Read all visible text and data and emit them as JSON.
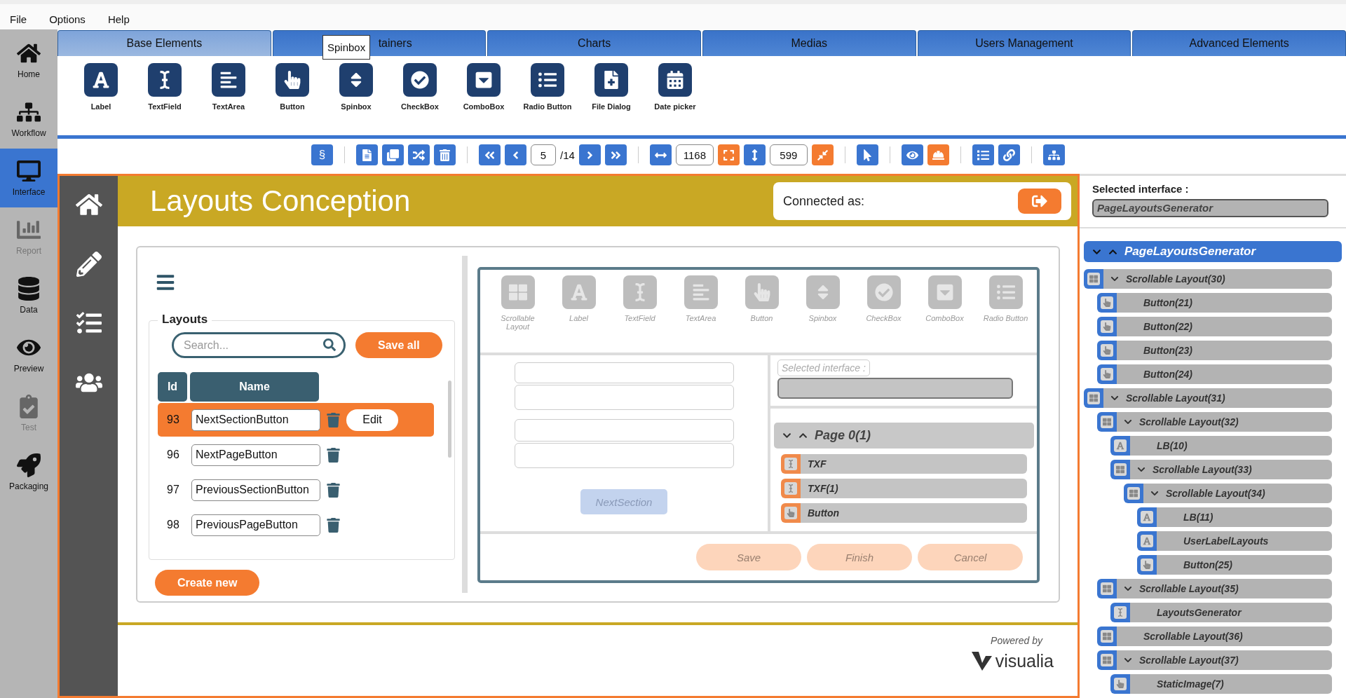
{
  "menu": [
    {
      "label": "File"
    },
    {
      "label": "Options"
    },
    {
      "label": "Help"
    }
  ],
  "nav": [
    {
      "label": "Home",
      "kind": "home",
      "selected": false,
      "disabled": false
    },
    {
      "label": "Workflow",
      "kind": "workflow",
      "selected": false,
      "disabled": false
    },
    {
      "label": "Interface",
      "kind": "interface",
      "selected": true,
      "disabled": false
    },
    {
      "label": "Report",
      "kind": "report",
      "selected": false,
      "disabled": true
    },
    {
      "label": "Data",
      "kind": "data",
      "selected": false,
      "disabled": false
    },
    {
      "label": "Preview",
      "kind": "preview",
      "selected": false,
      "disabled": false
    },
    {
      "label": "Test",
      "kind": "test",
      "selected": false,
      "disabled": true
    },
    {
      "label": "Packaging",
      "kind": "packaging",
      "selected": false,
      "disabled": false
    }
  ],
  "tabs": [
    {
      "label": "Base Elements",
      "selected": true
    },
    {
      "label": "tainers",
      "selected": false
    },
    {
      "label": "Charts",
      "selected": false
    },
    {
      "label": "Medias",
      "selected": false
    },
    {
      "label": "Users Management",
      "selected": false
    },
    {
      "label": "Advanced Elements",
      "selected": false
    }
  ],
  "tooltip": "Spinbox",
  "palette": [
    {
      "label": "Label",
      "kind": "label"
    },
    {
      "label": "TextField",
      "kind": "textfield"
    },
    {
      "label": "TextArea",
      "kind": "textarea"
    },
    {
      "label": "Button",
      "kind": "button"
    },
    {
      "label": "Spinbox",
      "kind": "spinbox"
    },
    {
      "label": "CheckBox",
      "kind": "checkbox"
    },
    {
      "label": "ComboBox",
      "kind": "combobox"
    },
    {
      "label": "Radio Button",
      "kind": "radio"
    },
    {
      "label": "File Dialog",
      "kind": "filedialog"
    },
    {
      "label": "Date picker",
      "kind": "datepicker"
    }
  ],
  "toolbar": [
    {
      "kind": "button",
      "label": "§",
      "active": false
    },
    {
      "kind": "separator"
    },
    {
      "kind": "button",
      "active": false
    },
    {
      "kind": "button",
      "active": false
    },
    {
      "kind": "button",
      "active": false
    },
    {
      "kind": "button",
      "active": false
    },
    {
      "kind": "separator"
    },
    {
      "kind": "button",
      "active": false
    },
    {
      "kind": "button",
      "active": false
    },
    {
      "kind": "field",
      "value": "5"
    },
    {
      "kind": "text",
      "text": "/14"
    },
    {
      "kind": "button",
      "active": false
    },
    {
      "kind": "button",
      "active": false
    },
    {
      "kind": "separator"
    },
    {
      "kind": "button",
      "active": false
    },
    {
      "kind": "field",
      "value": "1168"
    },
    {
      "kind": "button",
      "active": true
    },
    {
      "kind": "button",
      "active": false
    },
    {
      "kind": "field",
      "value": "599"
    },
    {
      "kind": "button",
      "active": true
    },
    {
      "kind": "separator"
    },
    {
      "kind": "button",
      "active": false
    },
    {
      "kind": "separator"
    },
    {
      "kind": "button",
      "active": false
    },
    {
      "kind": "button",
      "active": true
    },
    {
      "kind": "separator"
    },
    {
      "kind": "button",
      "active": false
    },
    {
      "kind": "button",
      "active": false
    },
    {
      "kind": "separator"
    },
    {
      "kind": "button",
      "active": false
    }
  ],
  "header": {
    "title": "Layouts Conception",
    "connected_label": "Connected as:"
  },
  "layouts": {
    "title": "Layouts",
    "search_placeholder": "Search...",
    "save_label": "Save all",
    "columns": [
      "Id",
      "Name"
    ],
    "rows": [
      {
        "id": "93",
        "name": "NextSectionButton",
        "selected": true,
        "action": "Edit"
      },
      {
        "id": "96",
        "name": "NextPageButton",
        "selected": false
      },
      {
        "id": "97",
        "name": "PreviousSectionButton",
        "selected": false
      },
      {
        "id": "98",
        "name": "PreviousPageButton",
        "selected": false
      }
    ],
    "create_label": "Create new"
  },
  "preview": {
    "palette": [
      {
        "label": "Scrollable Layout",
        "kind": "layout"
      },
      {
        "label": "Label",
        "kind": "label"
      },
      {
        "label": "TextField",
        "kind": "textfield"
      },
      {
        "label": "TextArea",
        "kind": "textarea"
      },
      {
        "label": "Button",
        "kind": "button"
      },
      {
        "label": "Spinbox",
        "kind": "spinbox"
      },
      {
        "label": "CheckBox",
        "kind": "checkbox"
      },
      {
        "label": "ComboBox",
        "kind": "combobox"
      },
      {
        "label": "Radio Button",
        "kind": "radio"
      }
    ],
    "button": "NextSection",
    "interface_label": "Selected interface :",
    "page": {
      "label": "Page 0(1)",
      "expanded": true,
      "children": [
        {
          "label": "TXF",
          "kind": "textfield"
        },
        {
          "label": "TXF(1)",
          "kind": "textfield"
        },
        {
          "label": "Button",
          "kind": "button"
        }
      ]
    },
    "actions": [
      {
        "label": "Save",
        "disabled": true
      },
      {
        "label": "Finish",
        "disabled": true
      },
      {
        "label": "Cancel",
        "disabled": true
      }
    ]
  },
  "footer": {
    "powered_by": "Powered by",
    "logo": "visualia"
  },
  "right": {
    "label": "Selected interface :",
    "value": "PageLayoutsGenerator",
    "tree": {
      "label": "PageLayoutsGenerator",
      "expanded": true,
      "children": [
        {
          "label": "Scrollable Layout(30)",
          "kind": "layout",
          "expanded": true,
          "children": [
            {
              "label": "Button(21)",
              "kind": "button"
            },
            {
              "label": "Button(22)",
              "kind": "button"
            },
            {
              "label": "Button(23)",
              "kind": "button"
            },
            {
              "label": "Button(24)",
              "kind": "button"
            }
          ]
        },
        {
          "label": "Scrollable Layout(31)",
          "kind": "layout",
          "expanded": true,
          "children": [
            {
              "label": "Scrollable Layout(32)",
              "kind": "layout",
              "expanded": true,
              "children": [
                {
                  "label": "LB(10)",
                  "kind": "label"
                },
                {
                  "label": "Scrollable Layout(33)",
                  "kind": "layout",
                  "expanded": true,
                  "children": [
                    {
                      "label": "Scrollable Layout(34)",
                      "kind": "layout",
                      "expanded": true,
                      "children": [
                        {
                          "label": "LB(11)",
                          "kind": "label"
                        },
                        {
                          "label": "UserLabelLayouts",
                          "kind": "label"
                        },
                        {
                          "label": "Button(25)",
                          "kind": "button"
                        }
                      ]
                    }
                  ]
                }
              ]
            },
            {
              "label": "Scrollable Layout(35)",
              "kind": "layout",
              "expanded": true,
              "children": [
                {
                  "label": "LayoutsGenerator",
                  "kind": "textfield"
                }
              ]
            },
            {
              "label": "Scrollable Layout(36)",
              "kind": "layout"
            },
            {
              "label": "Scrollable Layout(37)",
              "kind": "layout",
              "expanded": true,
              "children": [
                {
                  "label": "StaticImage(7)",
                  "kind": "button"
                }
              ]
            }
          ]
        }
      ]
    }
  }
}
